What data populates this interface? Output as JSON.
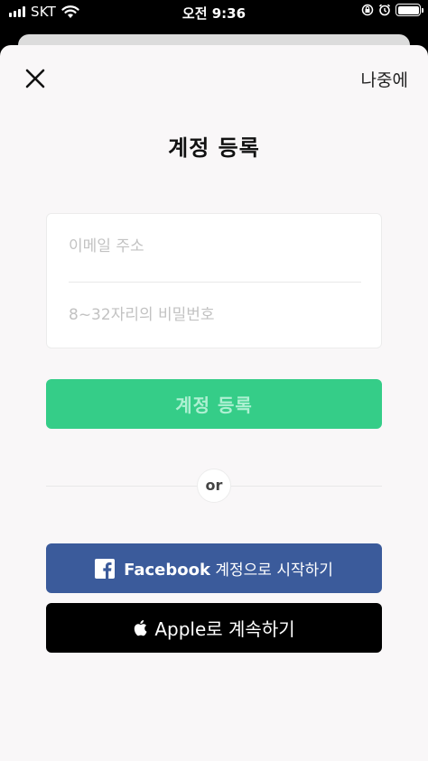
{
  "status_bar": {
    "carrier": "SKT",
    "time": "오전 9:36"
  },
  "header": {
    "later_label": "나중에"
  },
  "page": {
    "title": "계정 등록"
  },
  "form": {
    "email_placeholder": "이메일 주소",
    "email_value": "",
    "password_placeholder": "8~32자리의 비밀번호",
    "password_value": ""
  },
  "signup_button": {
    "label": "계정 등록"
  },
  "divider": {
    "label": "or"
  },
  "facebook_button": {
    "brand": "Facebook",
    "label": "계정으로 시작하기"
  },
  "apple_button": {
    "label": "Apple로 계속하기"
  },
  "colors": {
    "signup_green": "#35cd88",
    "facebook_blue": "#3b5b9b",
    "apple_black": "#000000",
    "sheet_background": "#f9f7f8"
  },
  "icons": [
    "close-icon",
    "facebook-icon",
    "apple-icon",
    "wifi-icon",
    "signal-icon",
    "battery-icon",
    "alarm-icon",
    "lock-rotation-icon"
  ]
}
